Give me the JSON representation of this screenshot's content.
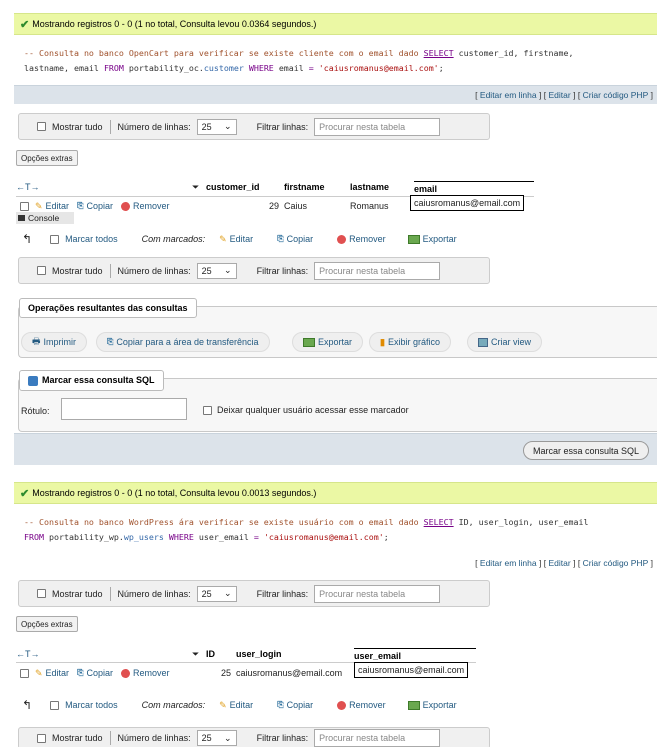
{
  "result1": {
    "success": "Mostrando registros 0 - 0 (1 no total, Consulta levou 0.0364 segundos.)",
    "sql_comment": "-- Consulta no banco OpenCart para verificar se existe cliente com o email dado",
    "sql_select": "SELECT",
    "sql_cols": "customer_id, firstname,",
    "sql_cols2": "lastname, email",
    "sql_from": "FROM",
    "sql_db": "portability_oc.",
    "sql_table": "customer",
    "sql_where": "WHERE",
    "sql_field": "email",
    "sql_eq": "=",
    "sql_value": "'caiusromanus@email.com'",
    "sql_end": ";"
  },
  "result2": {
    "success": "Mostrando registros 0 - 0 (1 no total, Consulta levou 0.0013 segundos.)",
    "sql_comment": "-- Consulta no banco WordPress ára verificar se existe usuário com o email dado",
    "sql_select": "SELECT",
    "sql_cols": "ID, user_login, user_email",
    "sql_from": "FROM",
    "sql_db": "portability_wp.",
    "sql_table": "wp_users",
    "sql_where": "WHERE",
    "sql_field": "user_email",
    "sql_eq": "=",
    "sql_value": "'caiusromanus@email.com'",
    "sql_end": ";"
  },
  "actions": {
    "edit_inline": "Editar em linha",
    "edit": "Editar",
    "php": "Criar código PHP",
    "lb": "[",
    "rb": "]"
  },
  "nav": {
    "show_all": "Mostrar tudo",
    "rows_label": "Número de linhas:",
    "rows_value": "25",
    "filter_label": "Filtrar linhas:",
    "filter_placeholder": "Procurar nesta tabela",
    "chevron": "⌄"
  },
  "extra_options": "Opções extras",
  "table1": {
    "arrows": "←T→",
    "sort_icon": "⏷",
    "headers": [
      "customer_id",
      "firstname",
      "lastname",
      "email"
    ],
    "row": {
      "edit": "Editar",
      "copy": "Copiar",
      "remove": "Remover",
      "values": [
        "29",
        "Caius",
        "Romanus",
        "caiusromanus@email.com"
      ]
    }
  },
  "table2": {
    "arrows": "←T→",
    "sort_icon": "⏷",
    "headers": [
      "ID",
      "user_login",
      "user_email"
    ],
    "row": {
      "edit": "Editar",
      "copy": "Copiar",
      "remove": "Remover",
      "values": [
        "25",
        "caiusromanus@email.com",
        "caiusromanus@email.com"
      ]
    }
  },
  "console": "Console",
  "bulk": {
    "mark_all": "Marcar todos",
    "with_marked": "Com marcados:",
    "edit": "Editar",
    "copy": "Copiar",
    "remove": "Remover",
    "export": "Exportar"
  },
  "ops": {
    "legend": "Operações resultantes das consultas",
    "print": "Imprimir",
    "copy_clip": "Copiar para a área de transferência",
    "export": "Exportar",
    "chart": "Exibir gráfico",
    "view": "Criar view"
  },
  "bookmark": {
    "legend": "Marcar essa consulta SQL",
    "label": "Rótulo:",
    "share": "Deixar qualquer usuário acessar esse marcador",
    "submit": "Marcar essa consulta SQL"
  },
  "colors": {
    "success_bg": "#ebf8a4",
    "link": "#235a81",
    "action_bg": "#dce3ea"
  }
}
